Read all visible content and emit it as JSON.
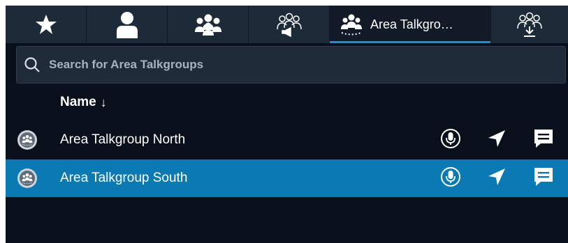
{
  "tabs": [
    {
      "name": "star-icon"
    },
    {
      "name": "person-icon"
    },
    {
      "name": "group-icon"
    },
    {
      "name": "broadcast-group-icon"
    },
    {
      "name": "area-talkgroup-icon",
      "label": "Area Talkgro…",
      "active": true
    },
    {
      "name": "download-group-icon"
    }
  ],
  "search": {
    "placeholder": "Search for Area Talkgroups"
  },
  "table": {
    "column_header": "Name",
    "sort_indicator": "↓",
    "rows": [
      {
        "name": "Area Talkgroup North",
        "selected": false
      },
      {
        "name": "Area Talkgroup South",
        "selected": true
      }
    ]
  },
  "colors": {
    "background": "#09101b",
    "tabbar": "#1d2a38",
    "accent": "#1d8fd1",
    "selected_row": "#0b7ab2"
  }
}
